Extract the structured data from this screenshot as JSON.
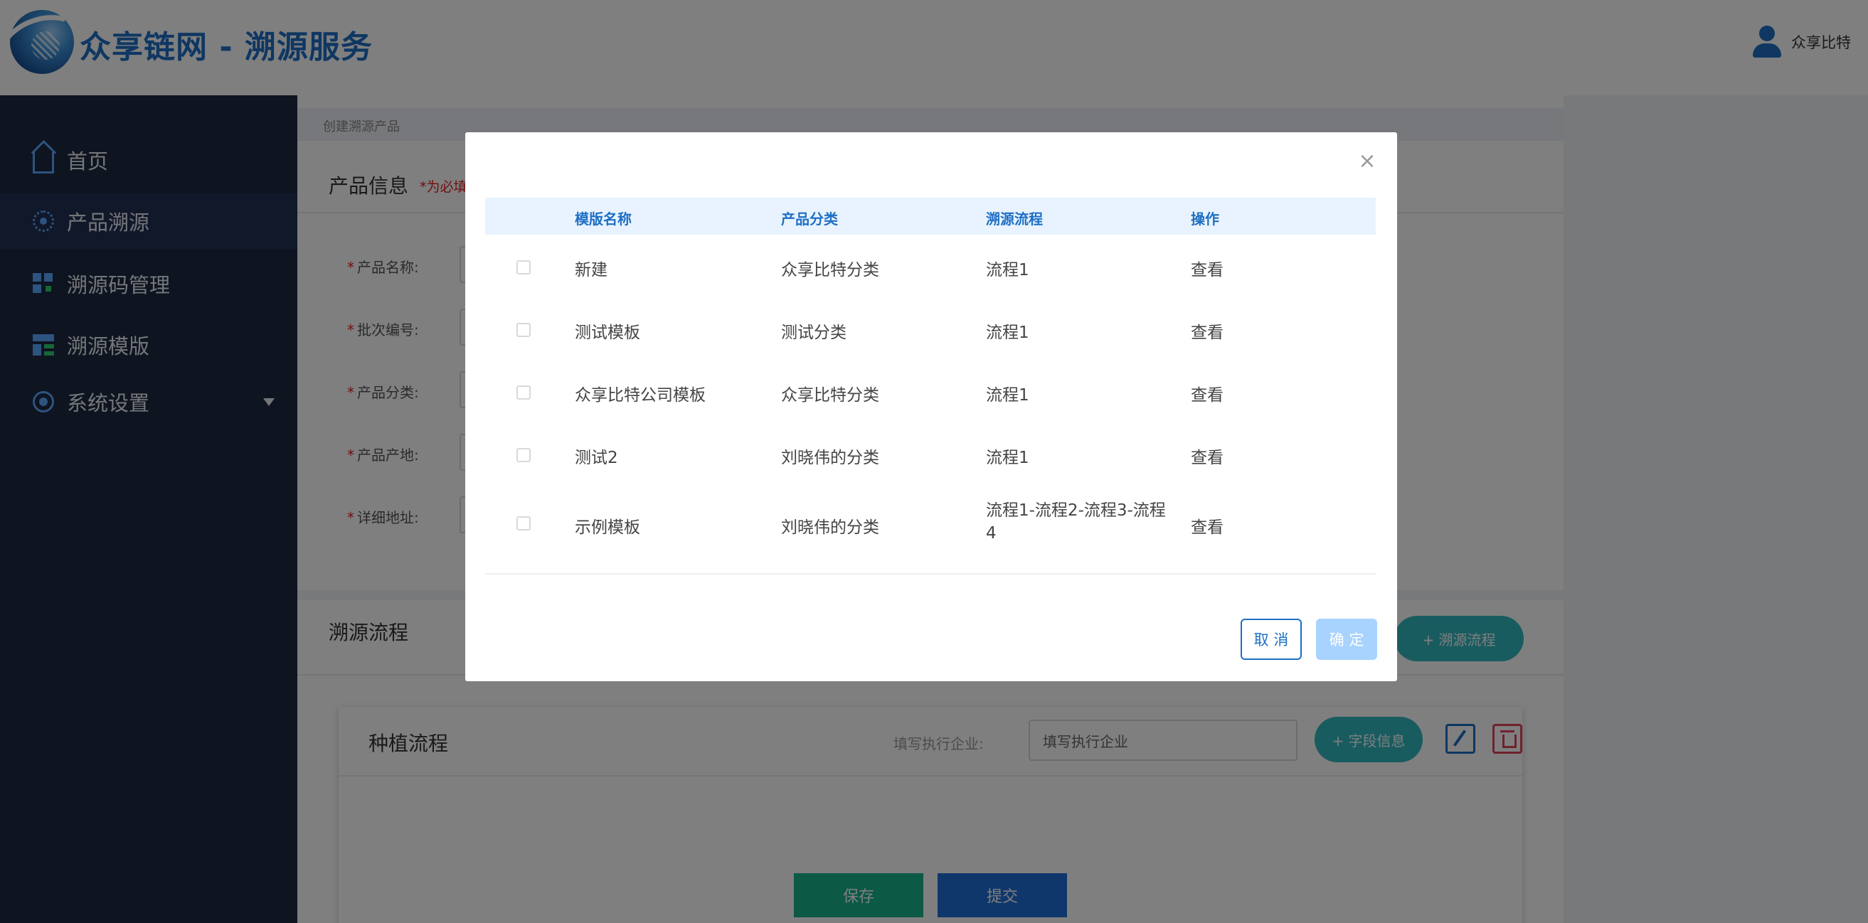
{
  "header": {
    "app_title": "众享链网 - 溯源服务",
    "user_name": "众享比特"
  },
  "sidebar": {
    "items": [
      {
        "label": "首页",
        "icon": "home-icon"
      },
      {
        "label": "产品溯源",
        "icon": "trace-icon"
      },
      {
        "label": "溯源码管理",
        "icon": "code-manage-icon"
      },
      {
        "label": "溯源模版",
        "icon": "template-icon"
      },
      {
        "label": "系统设置",
        "icon": "settings-icon"
      }
    ]
  },
  "main": {
    "breadcrumb": "创建溯源产品",
    "product_info_title": "产品信息",
    "required_note": "*为必填",
    "form_labels": [
      {
        "star": "*",
        "label": "产品名称:"
      },
      {
        "star": "*",
        "label": "批次编号:"
      },
      {
        "star": "*",
        "label": "产品分类:"
      },
      {
        "star": "*",
        "label": "产品产地:"
      },
      {
        "star": "*",
        "label": "详细地址:"
      }
    ],
    "trace_flow_title": "溯源流程",
    "add_flow_label": "+ 溯源流程",
    "flow_card": {
      "title": "种植流程",
      "exec_label": "填写执行企业:",
      "exec_placeholder": "填写执行企业",
      "add_field_label": "+ 字段信息"
    },
    "save_label": "保存",
    "submit_label": "提交"
  },
  "modal": {
    "close_label": "×",
    "columns": [
      "模版名称",
      "产品分类",
      "溯源流程",
      "操作"
    ],
    "rows": [
      {
        "name": "新建",
        "category": "众享比特分类",
        "flow": "流程1",
        "action": "查看"
      },
      {
        "name": "测试模板",
        "category": "测试分类",
        "flow": "流程1",
        "action": "查看"
      },
      {
        "name": "众享比特公司模板",
        "category": "众享比特分类",
        "flow": "流程1",
        "action": "查看"
      },
      {
        "name": "测试2",
        "category": "刘晓伟的分类",
        "flow": "流程1",
        "action": "查看"
      },
      {
        "name": "示例模板",
        "category": "刘晓伟的分类",
        "flow": "流程1-流程2-流程3-流程4",
        "action": "查看"
      }
    ],
    "cancel_label": "取 消",
    "ok_label": "确 定"
  },
  "colors": {
    "brand_blue": "#1e6fc4",
    "sidebar_bg": "#1c2841",
    "teal": "#32b9c0",
    "save_green": "#19b38b",
    "submit_blue": "#1e6fd9",
    "danger_red": "#e0445a"
  }
}
